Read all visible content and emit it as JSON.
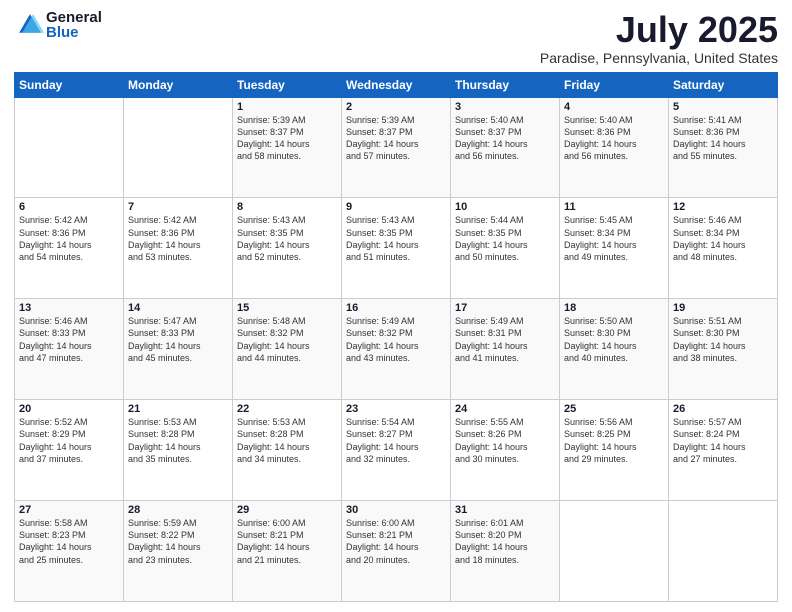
{
  "header": {
    "logo_general": "General",
    "logo_blue": "Blue",
    "month_year": "July 2025",
    "location": "Paradise, Pennsylvania, United States"
  },
  "days_of_week": [
    "Sunday",
    "Monday",
    "Tuesday",
    "Wednesday",
    "Thursday",
    "Friday",
    "Saturday"
  ],
  "weeks": [
    [
      {
        "day": "",
        "sunrise": "",
        "sunset": "",
        "daylight": ""
      },
      {
        "day": "",
        "sunrise": "",
        "sunset": "",
        "daylight": ""
      },
      {
        "day": "1",
        "sunrise": "Sunrise: 5:39 AM",
        "sunset": "Sunset: 8:37 PM",
        "daylight": "Daylight: 14 hours and 58 minutes."
      },
      {
        "day": "2",
        "sunrise": "Sunrise: 5:39 AM",
        "sunset": "Sunset: 8:37 PM",
        "daylight": "Daylight: 14 hours and 57 minutes."
      },
      {
        "day": "3",
        "sunrise": "Sunrise: 5:40 AM",
        "sunset": "Sunset: 8:37 PM",
        "daylight": "Daylight: 14 hours and 56 minutes."
      },
      {
        "day": "4",
        "sunrise": "Sunrise: 5:40 AM",
        "sunset": "Sunset: 8:36 PM",
        "daylight": "Daylight: 14 hours and 56 minutes."
      },
      {
        "day": "5",
        "sunrise": "Sunrise: 5:41 AM",
        "sunset": "Sunset: 8:36 PM",
        "daylight": "Daylight: 14 hours and 55 minutes."
      }
    ],
    [
      {
        "day": "6",
        "sunrise": "Sunrise: 5:42 AM",
        "sunset": "Sunset: 8:36 PM",
        "daylight": "Daylight: 14 hours and 54 minutes."
      },
      {
        "day": "7",
        "sunrise": "Sunrise: 5:42 AM",
        "sunset": "Sunset: 8:36 PM",
        "daylight": "Daylight: 14 hours and 53 minutes."
      },
      {
        "day": "8",
        "sunrise": "Sunrise: 5:43 AM",
        "sunset": "Sunset: 8:35 PM",
        "daylight": "Daylight: 14 hours and 52 minutes."
      },
      {
        "day": "9",
        "sunrise": "Sunrise: 5:43 AM",
        "sunset": "Sunset: 8:35 PM",
        "daylight": "Daylight: 14 hours and 51 minutes."
      },
      {
        "day": "10",
        "sunrise": "Sunrise: 5:44 AM",
        "sunset": "Sunset: 8:35 PM",
        "daylight": "Daylight: 14 hours and 50 minutes."
      },
      {
        "day": "11",
        "sunrise": "Sunrise: 5:45 AM",
        "sunset": "Sunset: 8:34 PM",
        "daylight": "Daylight: 14 hours and 49 minutes."
      },
      {
        "day": "12",
        "sunrise": "Sunrise: 5:46 AM",
        "sunset": "Sunset: 8:34 PM",
        "daylight": "Daylight: 14 hours and 48 minutes."
      }
    ],
    [
      {
        "day": "13",
        "sunrise": "Sunrise: 5:46 AM",
        "sunset": "Sunset: 8:33 PM",
        "daylight": "Daylight: 14 hours and 47 minutes."
      },
      {
        "day": "14",
        "sunrise": "Sunrise: 5:47 AM",
        "sunset": "Sunset: 8:33 PM",
        "daylight": "Daylight: 14 hours and 45 minutes."
      },
      {
        "day": "15",
        "sunrise": "Sunrise: 5:48 AM",
        "sunset": "Sunset: 8:32 PM",
        "daylight": "Daylight: 14 hours and 44 minutes."
      },
      {
        "day": "16",
        "sunrise": "Sunrise: 5:49 AM",
        "sunset": "Sunset: 8:32 PM",
        "daylight": "Daylight: 14 hours and 43 minutes."
      },
      {
        "day": "17",
        "sunrise": "Sunrise: 5:49 AM",
        "sunset": "Sunset: 8:31 PM",
        "daylight": "Daylight: 14 hours and 41 minutes."
      },
      {
        "day": "18",
        "sunrise": "Sunrise: 5:50 AM",
        "sunset": "Sunset: 8:30 PM",
        "daylight": "Daylight: 14 hours and 40 minutes."
      },
      {
        "day": "19",
        "sunrise": "Sunrise: 5:51 AM",
        "sunset": "Sunset: 8:30 PM",
        "daylight": "Daylight: 14 hours and 38 minutes."
      }
    ],
    [
      {
        "day": "20",
        "sunrise": "Sunrise: 5:52 AM",
        "sunset": "Sunset: 8:29 PM",
        "daylight": "Daylight: 14 hours and 37 minutes."
      },
      {
        "day": "21",
        "sunrise": "Sunrise: 5:53 AM",
        "sunset": "Sunset: 8:28 PM",
        "daylight": "Daylight: 14 hours and 35 minutes."
      },
      {
        "day": "22",
        "sunrise": "Sunrise: 5:53 AM",
        "sunset": "Sunset: 8:28 PM",
        "daylight": "Daylight: 14 hours and 34 minutes."
      },
      {
        "day": "23",
        "sunrise": "Sunrise: 5:54 AM",
        "sunset": "Sunset: 8:27 PM",
        "daylight": "Daylight: 14 hours and 32 minutes."
      },
      {
        "day": "24",
        "sunrise": "Sunrise: 5:55 AM",
        "sunset": "Sunset: 8:26 PM",
        "daylight": "Daylight: 14 hours and 30 minutes."
      },
      {
        "day": "25",
        "sunrise": "Sunrise: 5:56 AM",
        "sunset": "Sunset: 8:25 PM",
        "daylight": "Daylight: 14 hours and 29 minutes."
      },
      {
        "day": "26",
        "sunrise": "Sunrise: 5:57 AM",
        "sunset": "Sunset: 8:24 PM",
        "daylight": "Daylight: 14 hours and 27 minutes."
      }
    ],
    [
      {
        "day": "27",
        "sunrise": "Sunrise: 5:58 AM",
        "sunset": "Sunset: 8:23 PM",
        "daylight": "Daylight: 14 hours and 25 minutes."
      },
      {
        "day": "28",
        "sunrise": "Sunrise: 5:59 AM",
        "sunset": "Sunset: 8:22 PM",
        "daylight": "Daylight: 14 hours and 23 minutes."
      },
      {
        "day": "29",
        "sunrise": "Sunrise: 6:00 AM",
        "sunset": "Sunset: 8:21 PM",
        "daylight": "Daylight: 14 hours and 21 minutes."
      },
      {
        "day": "30",
        "sunrise": "Sunrise: 6:00 AM",
        "sunset": "Sunset: 8:21 PM",
        "daylight": "Daylight: 14 hours and 20 minutes."
      },
      {
        "day": "31",
        "sunrise": "Sunrise: 6:01 AM",
        "sunset": "Sunset: 8:20 PM",
        "daylight": "Daylight: 14 hours and 18 minutes."
      },
      {
        "day": "",
        "sunrise": "",
        "sunset": "",
        "daylight": ""
      },
      {
        "day": "",
        "sunrise": "",
        "sunset": "",
        "daylight": ""
      }
    ]
  ]
}
